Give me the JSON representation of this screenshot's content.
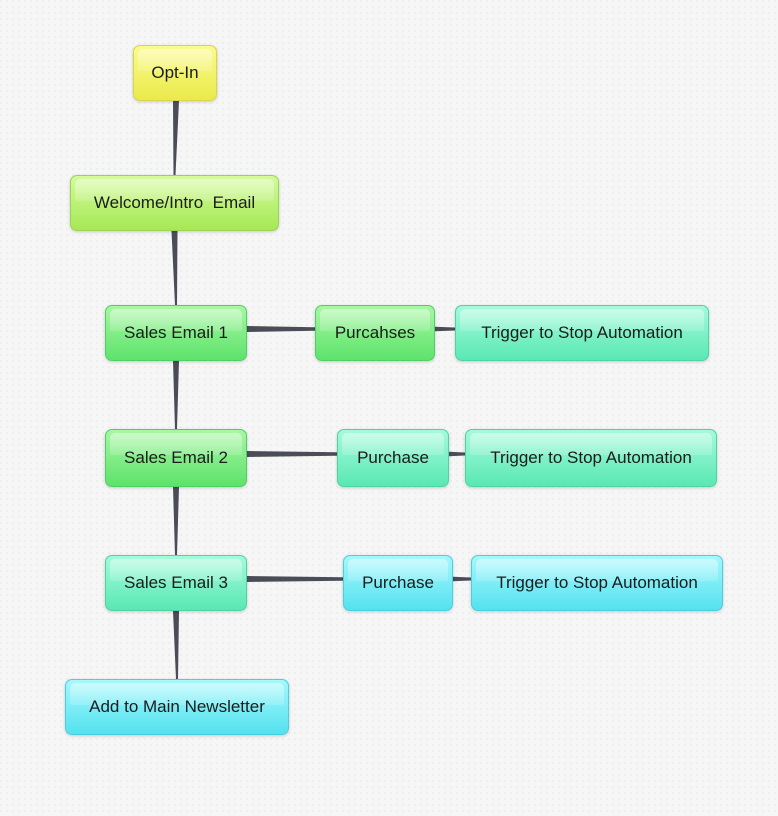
{
  "diagram": {
    "type": "flowchart",
    "nodes": [
      {
        "id": "optin",
        "label": "Opt-In",
        "color": "#f4f46a"
      },
      {
        "id": "welcome",
        "label": "Welcome/Intro  Email",
        "color": "#bff27a"
      },
      {
        "id": "sales1",
        "label": "Sales Email 1",
        "color": "#7eec85"
      },
      {
        "id": "purchase1",
        "label": "Purcahses",
        "color": "#7eec85"
      },
      {
        "id": "trigger1",
        "label": "Trigger to Stop Automation",
        "color": "#7ef2c8"
      },
      {
        "id": "sales2",
        "label": "Sales Email 2",
        "color": "#7eec85"
      },
      {
        "id": "purchase2",
        "label": "Purchase",
        "color": "#7ef2c8"
      },
      {
        "id": "trigger2",
        "label": "Trigger to Stop Automation",
        "color": "#7ef2c8"
      },
      {
        "id": "sales3",
        "label": "Sales Email 3",
        "color": "#7ef2c8"
      },
      {
        "id": "purchase3",
        "label": "Purchase",
        "color": "#7eedf6"
      },
      {
        "id": "trigger3",
        "label": "Trigger to Stop Automation",
        "color": "#7eedf6"
      },
      {
        "id": "newsletter",
        "label": "Add to Main Newsletter",
        "color": "#7eedf6"
      }
    ],
    "edges": [
      {
        "from": "optin",
        "to": "welcome"
      },
      {
        "from": "welcome",
        "to": "sales1"
      },
      {
        "from": "sales1",
        "to": "purchase1"
      },
      {
        "from": "purchase1",
        "to": "trigger1"
      },
      {
        "from": "sales1",
        "to": "sales2"
      },
      {
        "from": "sales2",
        "to": "purchase2"
      },
      {
        "from": "purchase2",
        "to": "trigger2"
      },
      {
        "from": "sales2",
        "to": "sales3"
      },
      {
        "from": "sales3",
        "to": "purchase3"
      },
      {
        "from": "purchase3",
        "to": "trigger3"
      },
      {
        "from": "sales3",
        "to": "newsletter"
      }
    ],
    "edge_color": "#4a4d57"
  }
}
